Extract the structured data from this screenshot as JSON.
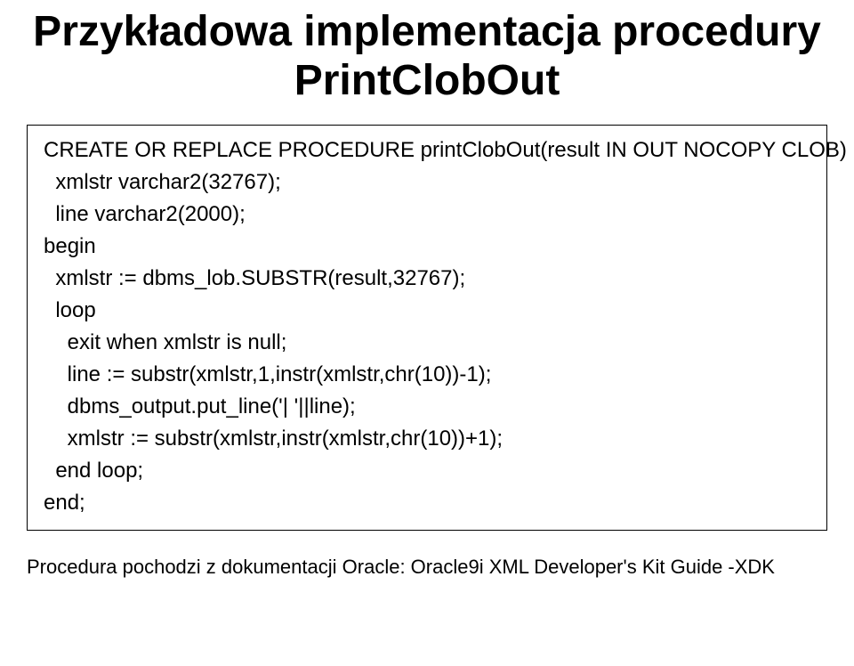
{
  "title": "Przykładowa implementacja procedury\nPrintClobOut",
  "code": "CREATE OR REPLACE PROCEDURE printClobOut(result IN OUT NOCOPY CLOB) is\n  xmlstr varchar2(32767);\n  line varchar2(2000);\nbegin\n  xmlstr := dbms_lob.SUBSTR(result,32767);\n  loop\n    exit when xmlstr is null;\n    line := substr(xmlstr,1,instr(xmlstr,chr(10))-1);\n    dbms_output.put_line('| '||line);\n    xmlstr := substr(xmlstr,instr(xmlstr,chr(10))+1);\n  end loop;\nend;",
  "footnote": "Procedura pochodzi z dokumentacji Oracle: Oracle9i XML Developer's Kit Guide -XDK"
}
